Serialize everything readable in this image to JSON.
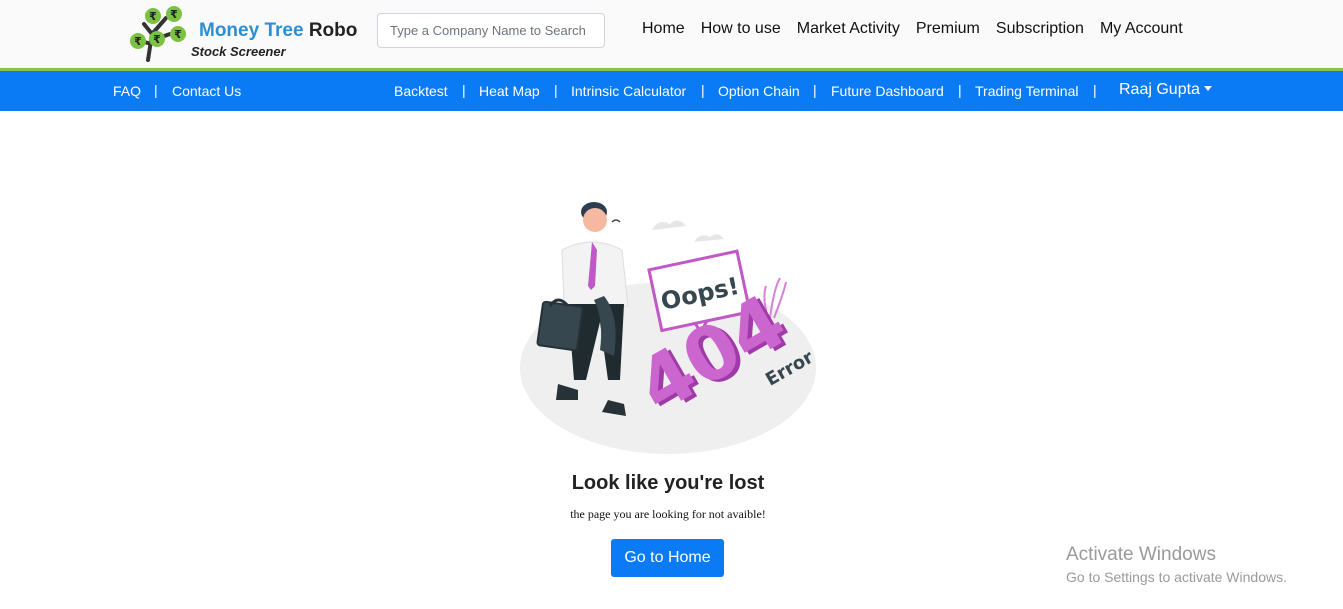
{
  "header": {
    "brand_part1": "Money Tree",
    "brand_part2": "Robo",
    "tagline": "Stock Screener",
    "search_placeholder": "Type a Company Name to Search",
    "nav": [
      "Home",
      "How to use",
      "Market Activity",
      "Premium",
      "Subscription",
      "My Account"
    ]
  },
  "subnav": {
    "left": [
      "FAQ",
      "Contact Us"
    ],
    "right": [
      "Backtest",
      "Heat Map",
      "Intrinsic Calculator",
      "Option Chain",
      "Future Dashboard",
      "Trading Terminal"
    ],
    "separator": "|",
    "user_name": "Raaj Gupta"
  },
  "error": {
    "illustration_text_oops": "Oops!",
    "illustration_text_code": "404",
    "illustration_text_error": "Error",
    "title": "Look like you're lost",
    "message": "the page you are looking for not avaible!",
    "button_label": "Go to Home"
  },
  "watermark": {
    "line1": "Activate Windows",
    "line2": "Go to Settings to activate Windows."
  },
  "colors": {
    "accent_blue": "#0a7bf5",
    "accent_green": "#8bc34a",
    "illustration_purple": "#c058c6"
  }
}
